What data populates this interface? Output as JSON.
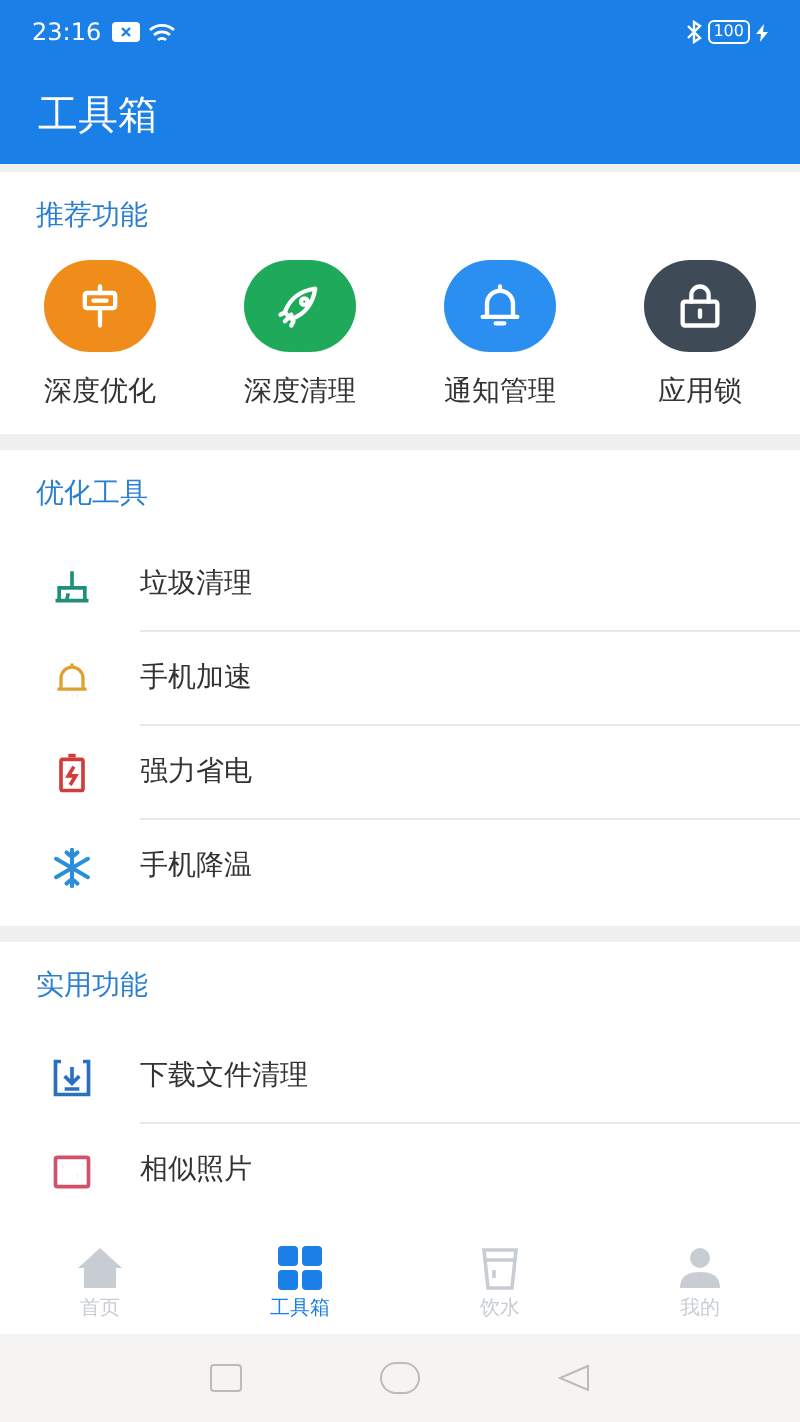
{
  "status_bar": {
    "time": "23:16",
    "battery": "100"
  },
  "header": {
    "title": "工具箱"
  },
  "recommended": {
    "title": "推荐功能",
    "items": [
      {
        "label": "深度优化",
        "kind": "optimize",
        "color": "#f08c1a"
      },
      {
        "label": "深度清理",
        "kind": "rocket",
        "color": "#1fa95a"
      },
      {
        "label": "通知管理",
        "kind": "bell",
        "color": "#2a8ff0"
      },
      {
        "label": "应用锁",
        "kind": "lock",
        "color": "#3f4a57"
      }
    ]
  },
  "optimize_tools": {
    "title": "优化工具",
    "items": [
      {
        "label": "垃圾清理",
        "kind": "broom"
      },
      {
        "label": "手机加速",
        "kind": "bell"
      },
      {
        "label": "强力省电",
        "kind": "battery"
      },
      {
        "label": "手机降温",
        "kind": "snowflake"
      }
    ]
  },
  "utilities": {
    "title": "实用功能",
    "items": [
      {
        "label": "下载文件清理",
        "kind": "download"
      },
      {
        "label": "相似照片",
        "kind": "photo"
      }
    ]
  },
  "bottom_nav": [
    {
      "label": "首页",
      "kind": "home",
      "selected": false
    },
    {
      "label": "工具箱",
      "kind": "grid",
      "selected": true
    },
    {
      "label": "饮水",
      "kind": "cup",
      "selected": false
    },
    {
      "label": "我的",
      "kind": "user",
      "selected": false
    }
  ]
}
